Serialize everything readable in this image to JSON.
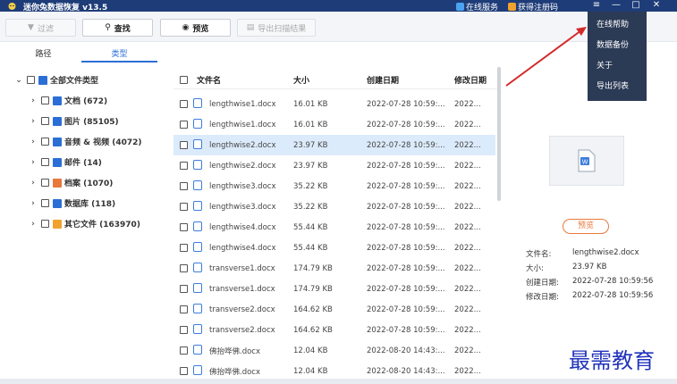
{
  "titlebar": {
    "title": "迷你兔数据恢复 v13.5",
    "links": [
      "在线服务",
      "获得注册码"
    ],
    "controls": [
      "≡",
      "—",
      "□",
      "✕"
    ]
  },
  "toolbar": {
    "filter": "过滤",
    "find": "查找",
    "preview": "预览",
    "export_results": "导出扫描结果"
  },
  "left_panel": {
    "tabs": [
      "路径",
      "类型"
    ],
    "tree": [
      {
        "label": "全部文件类型",
        "icon": "monitor-icon",
        "color": "#2b6fd6"
      },
      {
        "label": "文档 (672)",
        "icon": "document-icon",
        "color": "#2b6fd6"
      },
      {
        "label": "图片 (85105)",
        "icon": "image-icon",
        "color": "#2b6fd6"
      },
      {
        "label": "音频 & 视频 (4072)",
        "icon": "video-icon",
        "color": "#2b6fd6"
      },
      {
        "label": "邮件 (14)",
        "icon": "mail-icon",
        "color": "#2b6fd6"
      },
      {
        "label": "档案 (1070)",
        "icon": "archive-icon",
        "color": "#e8793c"
      },
      {
        "label": "数据库 (118)",
        "icon": "database-icon",
        "color": "#2b6fd6"
      },
      {
        "label": "其它文件 (163970)",
        "icon": "other-file-icon",
        "color": "#f0a22e"
      }
    ]
  },
  "list": {
    "headers": {
      "name": "文件名",
      "size": "大小",
      "created": "创建日期",
      "modified": "修改日期"
    },
    "rows": [
      {
        "name": "lengthwise1.docx",
        "size": "16.01 KB",
        "created": "2022-07-28 10:59:...",
        "modified": "2022...",
        "selected": false
      },
      {
        "name": "lengthwise1.docx",
        "size": "16.01 KB",
        "created": "2022-07-28 10:59:...",
        "modified": "2022...",
        "selected": false
      },
      {
        "name": "lengthwise2.docx",
        "size": "23.97 KB",
        "created": "2022-07-28 10:59:...",
        "modified": "2022...",
        "selected": true
      },
      {
        "name": "lengthwise2.docx",
        "size": "23.97 KB",
        "created": "2022-07-28 10:59:...",
        "modified": "2022...",
        "selected": false
      },
      {
        "name": "lengthwise3.docx",
        "size": "35.22 KB",
        "created": "2022-07-28 10:59:...",
        "modified": "2022...",
        "selected": false
      },
      {
        "name": "lengthwise3.docx",
        "size": "35.22 KB",
        "created": "2022-07-28 10:59:...",
        "modified": "2022...",
        "selected": false
      },
      {
        "name": "lengthwise4.docx",
        "size": "55.44 KB",
        "created": "2022-07-28 10:59:...",
        "modified": "2022...",
        "selected": false
      },
      {
        "name": "lengthwise4.docx",
        "size": "55.44 KB",
        "created": "2022-07-28 10:59:...",
        "modified": "2022...",
        "selected": false
      },
      {
        "name": "transverse1.docx",
        "size": "174.79 KB",
        "created": "2022-07-28 10:59:...",
        "modified": "2022...",
        "selected": false
      },
      {
        "name": "transverse1.docx",
        "size": "174.79 KB",
        "created": "2022-07-28 10:59:...",
        "modified": "2022...",
        "selected": false
      },
      {
        "name": "transverse2.docx",
        "size": "164.62 KB",
        "created": "2022-07-28 10:59:...",
        "modified": "2022...",
        "selected": false
      },
      {
        "name": "transverse2.docx",
        "size": "164.62 KB",
        "created": "2022-07-28 10:59:...",
        "modified": "2022...",
        "selected": false
      },
      {
        "name": "佛抬哗佛.docx",
        "size": "12.04 KB",
        "created": "2022-08-20 14:43:...",
        "modified": "2022...",
        "selected": false
      },
      {
        "name": "佛抬哗佛.docx",
        "size": "12.04 KB",
        "created": "2022-08-20 14:43:...",
        "modified": "2022...",
        "selected": false
      }
    ]
  },
  "preview": {
    "button": "预览",
    "meta": [
      {
        "key": "文件名:",
        "value": "lengthwise2.docx"
      },
      {
        "key": "大小:",
        "value": "23.97 KB"
      },
      {
        "key": "创建日期:",
        "value": "2022-07-28 10:59:56"
      },
      {
        "key": "修改日期:",
        "value": "2022-07-28 10:59:56"
      }
    ]
  },
  "menu": {
    "items": [
      "在线帮助",
      "数据备份",
      "关于",
      "导出列表"
    ]
  },
  "watermark": "最需教育",
  "colors": {
    "titlebar": "#1e3c78",
    "accent": "#2b6fd6",
    "menu_bg": "#2b3a55",
    "arrow": "#d42a2a"
  }
}
